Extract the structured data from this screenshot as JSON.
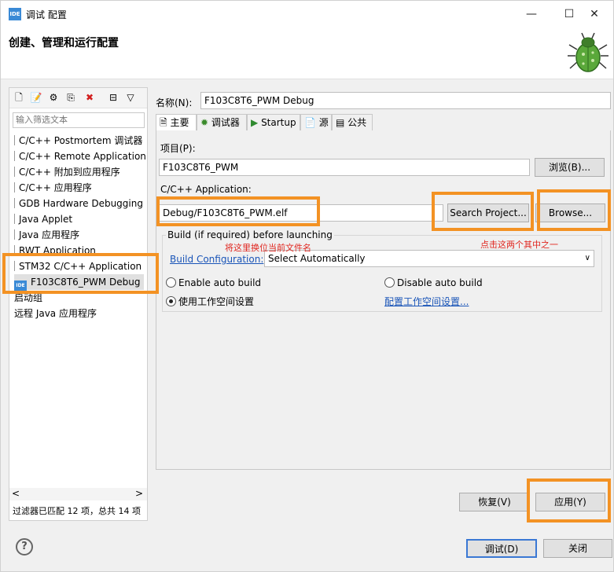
{
  "window": {
    "title": "调试 配置",
    "app_icon": "IDE",
    "minimize": "—",
    "maximize": "☐",
    "close": "✕"
  },
  "header": {
    "title": "创建、管理和运行配置"
  },
  "left": {
    "filter_placeholder": "输入筛选文本",
    "items": [
      "C/C++ Postmortem 调试器",
      "C/C++ Remote Application",
      "C/C++ 附加到应用程序",
      "C/C++ 应用程序",
      "GDB Hardware Debugging",
      "Java Applet",
      "Java 应用程序",
      "RWT Application",
      "STM32 C/C++ Application",
      "F103C8T6_PWM Debug",
      "启动组",
      "远程 Java 应用程序"
    ],
    "status": "过滤器已匹配 12 项，总共 14 项"
  },
  "name": {
    "label": "名称(N):",
    "value": "F103C8T6_PWM Debug"
  },
  "tabs": [
    "主要",
    "调试器",
    "Startup",
    "源",
    "公共"
  ],
  "main": {
    "project_label": "项目(P):",
    "project_value": "F103C8T6_PWM",
    "browse_cn": "浏览(B)...",
    "app_label": "C/C++ Application:",
    "app_value": "Debug/F103C8T6_PWM.elf",
    "search_project": "Search Project...",
    "browse": "Browse...",
    "annotation_replace": "将这里换位当前文件名",
    "annotation_choose": "点击这两个其中之一",
    "build_group_label": "Build (if required) before launching",
    "build_config_label": "Build Configuration:",
    "build_config_value": "Select Automatically",
    "enable_auto": "Enable auto build",
    "disable_auto": "Disable auto build",
    "use_workspace": "使用工作空间设置",
    "config_workspace": "配置工作空间设置..."
  },
  "buttons": {
    "revert": "恢复(V)",
    "apply": "应用(Y)",
    "debug": "调试(D)",
    "close": "关闭"
  },
  "help": "?"
}
